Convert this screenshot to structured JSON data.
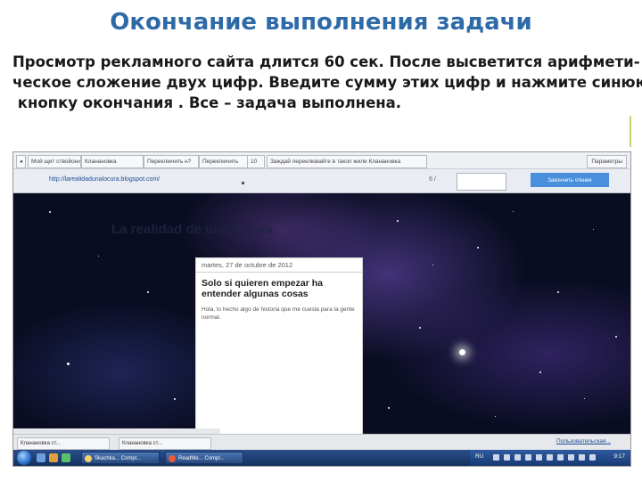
{
  "slide": {
    "title": "Окончание выполнения задачи",
    "lines": [
      "Просмотр рекламного сайта длится 60 сек. После высветится арифмети-",
      "ческое сложение двух цифр. Введите сумму этих цифр и нажмите синюю",
      " кнопку окончания . Все – задача выполнена."
    ]
  },
  "browser": {
    "tabs": [
      "Мой щит ствойонин",
      "Кланановка",
      "Переключить н?",
      "Переключить",
      "10",
      "Заждай переклювайте в такоп жили Кланановка"
    ],
    "tab_right": "Параметры",
    "url": "http://larealidadunalocura.blogspot.com/",
    "counter": "6 /",
    "answer_value": "",
    "finish_label": "Закончить чтение"
  },
  "blog": {
    "heading": "La realidad de una locura",
    "post_date": "martes, 27 de octubre de 2012",
    "post_title": "Solo si quieren empezar ha entender algunas cosas",
    "post_body": "Hola, lo hecho algo de historia que me cuesta para la gente normal."
  },
  "bottom_bar": {
    "items": [
      "Кланановка ст...",
      "Кланановка ст..."
    ],
    "link": "Пользовательская..."
  },
  "taskbar": {
    "buttons": [
      "Skachka... Compl...",
      "ReadMe... Compl..."
    ],
    "lang": "RU",
    "clock": "9:17"
  },
  "colors": {
    "title": "#2f6aa8",
    "finish_button": "#4a8fdc",
    "url": "#1f4e93"
  }
}
